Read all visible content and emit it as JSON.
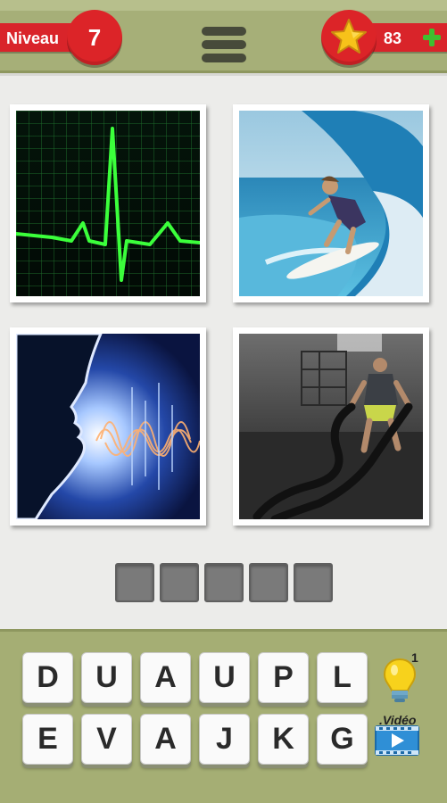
{
  "header": {
    "level_label": "Niveau",
    "level_number": "7",
    "coins": "83",
    "menu_icon": "hamburger-menu-icon",
    "star_icon": "star-icon",
    "add_icon": "plus-icon",
    "colors": {
      "bar": "#a6af78",
      "badge_red": "#d9242a",
      "star_yellow": "#f7c21a",
      "plus_green": "#3fbf2f"
    }
  },
  "puzzle": {
    "images": [
      {
        "name": "heartbeat-monitor-photo"
      },
      {
        "name": "surfer-wave-photo"
      },
      {
        "name": "voice-soundwave-photo"
      },
      {
        "name": "battle-ropes-workout-photo"
      }
    ],
    "answer_slots": [
      "",
      "",
      "",
      "",
      ""
    ]
  },
  "keyboard": {
    "rows": [
      [
        "D",
        "U",
        "A",
        "U",
        "P",
        "L"
      ],
      [
        "E",
        "V",
        "A",
        "J",
        "K",
        "G"
      ]
    ],
    "hint_count": "1",
    "video_label": ".Vidéo",
    "hint_icon": "lightbulb-icon",
    "video_icon": "video-play-icon"
  }
}
